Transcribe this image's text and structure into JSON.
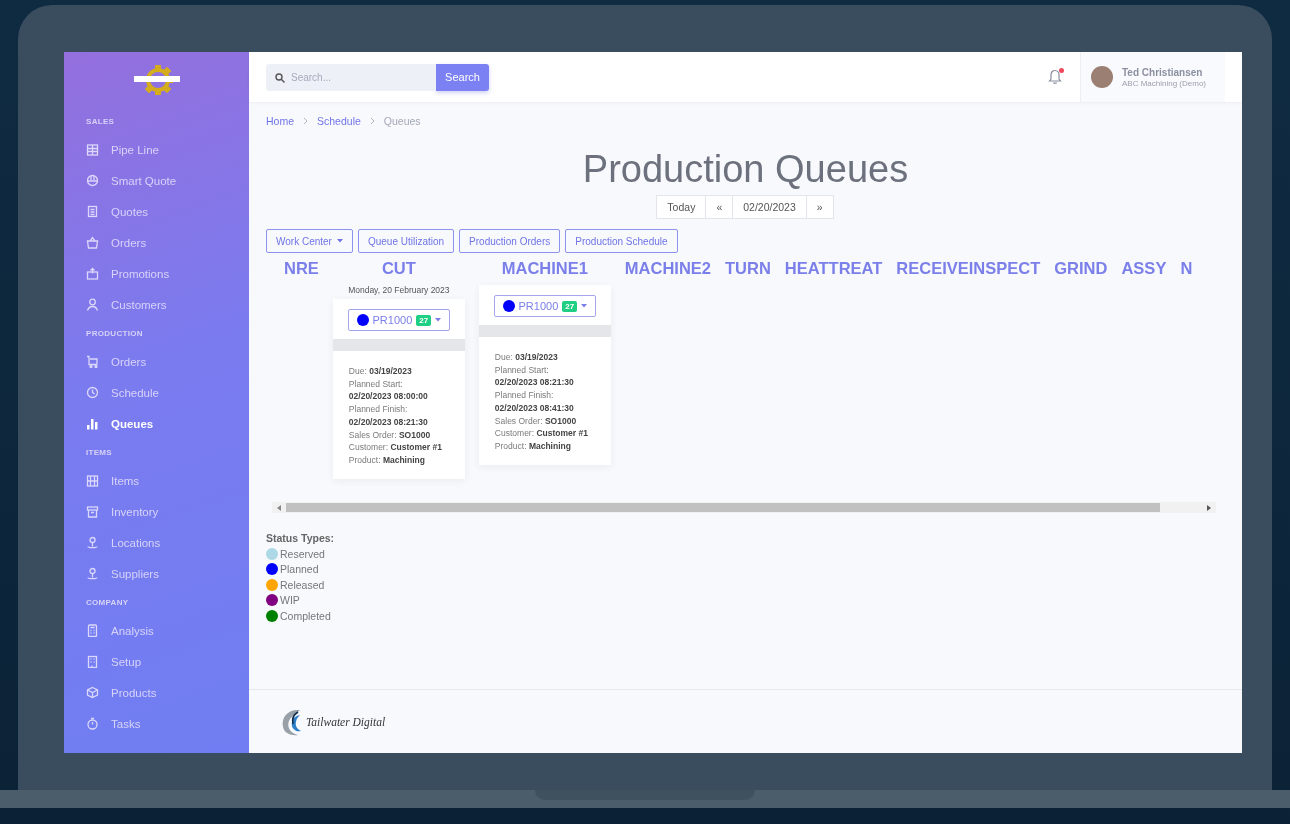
{
  "sidebar": {
    "sections": [
      {
        "title": "SALES",
        "items": [
          {
            "label": "Pipe Line",
            "selected": false
          },
          {
            "label": "Smart Quote",
            "selected": false
          },
          {
            "label": "Quotes",
            "selected": false
          },
          {
            "label": "Orders",
            "selected": false
          },
          {
            "label": "Promotions",
            "selected": false
          },
          {
            "label": "Customers",
            "selected": false
          }
        ]
      },
      {
        "title": "PRODUCTION",
        "items": [
          {
            "label": "Orders",
            "selected": false
          },
          {
            "label": "Schedule",
            "selected": false
          },
          {
            "label": "Queues",
            "selected": true
          }
        ]
      },
      {
        "title": "ITEMS",
        "items": [
          {
            "label": "Items",
            "selected": false
          },
          {
            "label": "Inventory",
            "selected": false
          },
          {
            "label": "Locations",
            "selected": false
          },
          {
            "label": "Suppliers",
            "selected": false
          }
        ]
      },
      {
        "title": "COMPANY",
        "items": [
          {
            "label": "Analysis",
            "selected": false
          },
          {
            "label": "Setup",
            "selected": false
          },
          {
            "label": "Products",
            "selected": false
          },
          {
            "label": "Tasks",
            "selected": false
          }
        ]
      }
    ]
  },
  "topbar": {
    "search": {
      "placeholder": "Search..."
    },
    "search_button": "Search",
    "notifications_unread": true,
    "user": {
      "name": "Ted Christiansen",
      "company": "ABC Machining (Demo)"
    }
  },
  "breadcrumb": [
    {
      "label": "Home",
      "current": false
    },
    {
      "label": "Schedule",
      "current": false
    },
    {
      "label": "Queues",
      "current": true
    }
  ],
  "page_title": "Production Queues",
  "date_nav": {
    "today": "Today",
    "prev": "«",
    "date": "02/20/2023",
    "next": "»"
  },
  "toolbar": [
    {
      "label": "Work Center",
      "dropdown": true
    },
    {
      "label": "Queue Utilization",
      "dropdown": false
    },
    {
      "label": "Production Orders",
      "dropdown": false
    },
    {
      "label": "Production Schedule",
      "dropdown": false
    }
  ],
  "work_centers": [
    {
      "name": "NRE"
    },
    {
      "name": "CUT",
      "orders": [
        {
          "date_label": "Monday, 20 February 2023",
          "color": "#0000ff",
          "number": "PR1000",
          "badge": "27",
          "fields": [
            {
              "kind": "inline",
              "label": "Due:",
              "value": "03/19/2023"
            },
            {
              "kind": "block",
              "label": "Planned Start:",
              "value": "02/20/2023 08:00:00"
            },
            {
              "kind": "block",
              "label": "Planned Finish:",
              "value": "02/20/2023 08:21:30"
            },
            {
              "kind": "inline",
              "label": "Sales Order:",
              "value": "SO1000"
            },
            {
              "kind": "inline",
              "label": "Customer:",
              "value": "Customer #1"
            },
            {
              "kind": "inline",
              "label": "Product:",
              "value": "Machining"
            }
          ]
        }
      ]
    },
    {
      "name": "MACHINE1",
      "orders": [
        {
          "color": "#0000ff",
          "number": "PR1000",
          "badge": "27",
          "fields": [
            {
              "kind": "inline",
              "label": "Due:",
              "value": "03/19/2023"
            },
            {
              "kind": "block",
              "label": "Planned Start:",
              "value": "02/20/2023 08:21:30"
            },
            {
              "kind": "block",
              "label": "Planned Finish:",
              "value": "02/20/2023 08:41:30"
            },
            {
              "kind": "inline",
              "label": "Sales Order:",
              "value": "SO1000"
            },
            {
              "kind": "inline",
              "label": "Customer:",
              "value": "Customer #1"
            },
            {
              "kind": "inline",
              "label": "Product:",
              "value": "Machining"
            }
          ]
        }
      ]
    },
    {
      "name": "MACHINE2"
    },
    {
      "name": "TURN"
    },
    {
      "name": "HEATTREAT"
    },
    {
      "name": "RECEIVEINSPECT"
    },
    {
      "name": "GRIND"
    },
    {
      "name": "ASSY"
    },
    {
      "name": "N"
    }
  ],
  "legend": {
    "title": "Status Types:",
    "items": [
      {
        "label": "Reserved",
        "color": "#add8e6"
      },
      {
        "label": "Planned",
        "color": "#0000ff"
      },
      {
        "label": "Released",
        "color": "#ffa500"
      },
      {
        "label": "WIP",
        "color": "#800080"
      },
      {
        "label": "Completed",
        "color": "#008000"
      }
    ]
  },
  "footer": {
    "brand": "Tailwater Digital"
  }
}
